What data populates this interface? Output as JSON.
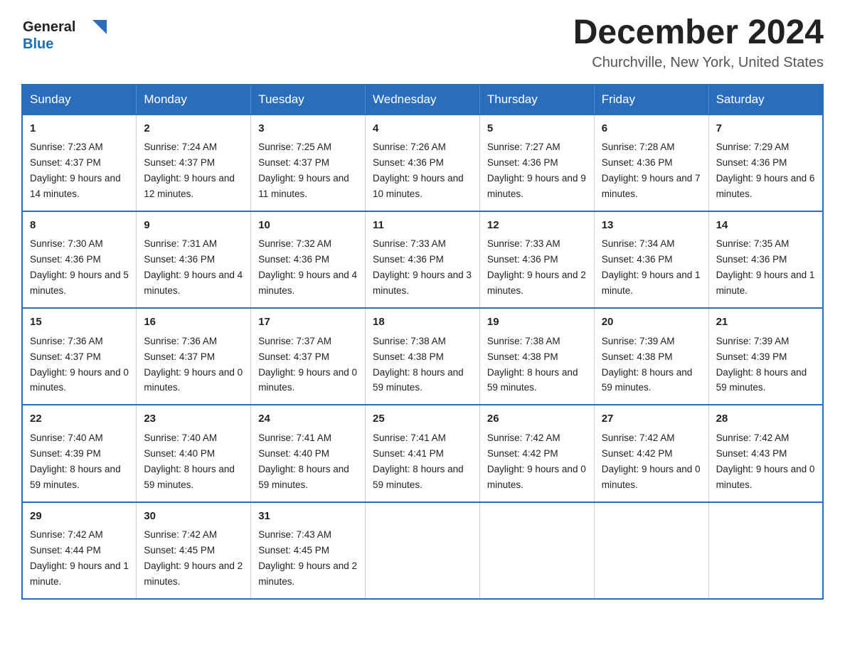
{
  "header": {
    "logo_general": "General",
    "logo_blue": "Blue",
    "month_title": "December 2024",
    "location": "Churchville, New York, United States"
  },
  "days_of_week": [
    "Sunday",
    "Monday",
    "Tuesday",
    "Wednesday",
    "Thursday",
    "Friday",
    "Saturday"
  ],
  "weeks": [
    [
      {
        "day": "1",
        "sunrise": "7:23 AM",
        "sunset": "4:37 PM",
        "daylight": "9 hours and 14 minutes."
      },
      {
        "day": "2",
        "sunrise": "7:24 AM",
        "sunset": "4:37 PM",
        "daylight": "9 hours and 12 minutes."
      },
      {
        "day": "3",
        "sunrise": "7:25 AM",
        "sunset": "4:37 PM",
        "daylight": "9 hours and 11 minutes."
      },
      {
        "day": "4",
        "sunrise": "7:26 AM",
        "sunset": "4:36 PM",
        "daylight": "9 hours and 10 minutes."
      },
      {
        "day": "5",
        "sunrise": "7:27 AM",
        "sunset": "4:36 PM",
        "daylight": "9 hours and 9 minutes."
      },
      {
        "day": "6",
        "sunrise": "7:28 AM",
        "sunset": "4:36 PM",
        "daylight": "9 hours and 7 minutes."
      },
      {
        "day": "7",
        "sunrise": "7:29 AM",
        "sunset": "4:36 PM",
        "daylight": "9 hours and 6 minutes."
      }
    ],
    [
      {
        "day": "8",
        "sunrise": "7:30 AM",
        "sunset": "4:36 PM",
        "daylight": "9 hours and 5 minutes."
      },
      {
        "day": "9",
        "sunrise": "7:31 AM",
        "sunset": "4:36 PM",
        "daylight": "9 hours and 4 minutes."
      },
      {
        "day": "10",
        "sunrise": "7:32 AM",
        "sunset": "4:36 PM",
        "daylight": "9 hours and 4 minutes."
      },
      {
        "day": "11",
        "sunrise": "7:33 AM",
        "sunset": "4:36 PM",
        "daylight": "9 hours and 3 minutes."
      },
      {
        "day": "12",
        "sunrise": "7:33 AM",
        "sunset": "4:36 PM",
        "daylight": "9 hours and 2 minutes."
      },
      {
        "day": "13",
        "sunrise": "7:34 AM",
        "sunset": "4:36 PM",
        "daylight": "9 hours and 1 minute."
      },
      {
        "day": "14",
        "sunrise": "7:35 AM",
        "sunset": "4:36 PM",
        "daylight": "9 hours and 1 minute."
      }
    ],
    [
      {
        "day": "15",
        "sunrise": "7:36 AM",
        "sunset": "4:37 PM",
        "daylight": "9 hours and 0 minutes."
      },
      {
        "day": "16",
        "sunrise": "7:36 AM",
        "sunset": "4:37 PM",
        "daylight": "9 hours and 0 minutes."
      },
      {
        "day": "17",
        "sunrise": "7:37 AM",
        "sunset": "4:37 PM",
        "daylight": "9 hours and 0 minutes."
      },
      {
        "day": "18",
        "sunrise": "7:38 AM",
        "sunset": "4:38 PM",
        "daylight": "8 hours and 59 minutes."
      },
      {
        "day": "19",
        "sunrise": "7:38 AM",
        "sunset": "4:38 PM",
        "daylight": "8 hours and 59 minutes."
      },
      {
        "day": "20",
        "sunrise": "7:39 AM",
        "sunset": "4:38 PM",
        "daylight": "8 hours and 59 minutes."
      },
      {
        "day": "21",
        "sunrise": "7:39 AM",
        "sunset": "4:39 PM",
        "daylight": "8 hours and 59 minutes."
      }
    ],
    [
      {
        "day": "22",
        "sunrise": "7:40 AM",
        "sunset": "4:39 PM",
        "daylight": "8 hours and 59 minutes."
      },
      {
        "day": "23",
        "sunrise": "7:40 AM",
        "sunset": "4:40 PM",
        "daylight": "8 hours and 59 minutes."
      },
      {
        "day": "24",
        "sunrise": "7:41 AM",
        "sunset": "4:40 PM",
        "daylight": "8 hours and 59 minutes."
      },
      {
        "day": "25",
        "sunrise": "7:41 AM",
        "sunset": "4:41 PM",
        "daylight": "8 hours and 59 minutes."
      },
      {
        "day": "26",
        "sunrise": "7:42 AM",
        "sunset": "4:42 PM",
        "daylight": "9 hours and 0 minutes."
      },
      {
        "day": "27",
        "sunrise": "7:42 AM",
        "sunset": "4:42 PM",
        "daylight": "9 hours and 0 minutes."
      },
      {
        "day": "28",
        "sunrise": "7:42 AM",
        "sunset": "4:43 PM",
        "daylight": "9 hours and 0 minutes."
      }
    ],
    [
      {
        "day": "29",
        "sunrise": "7:42 AM",
        "sunset": "4:44 PM",
        "daylight": "9 hours and 1 minute."
      },
      {
        "day": "30",
        "sunrise": "7:42 AM",
        "sunset": "4:45 PM",
        "daylight": "9 hours and 2 minutes."
      },
      {
        "day": "31",
        "sunrise": "7:43 AM",
        "sunset": "4:45 PM",
        "daylight": "9 hours and 2 minutes."
      },
      null,
      null,
      null,
      null
    ]
  ],
  "labels": {
    "sunrise": "Sunrise:",
    "sunset": "Sunset:",
    "daylight": "Daylight:"
  }
}
